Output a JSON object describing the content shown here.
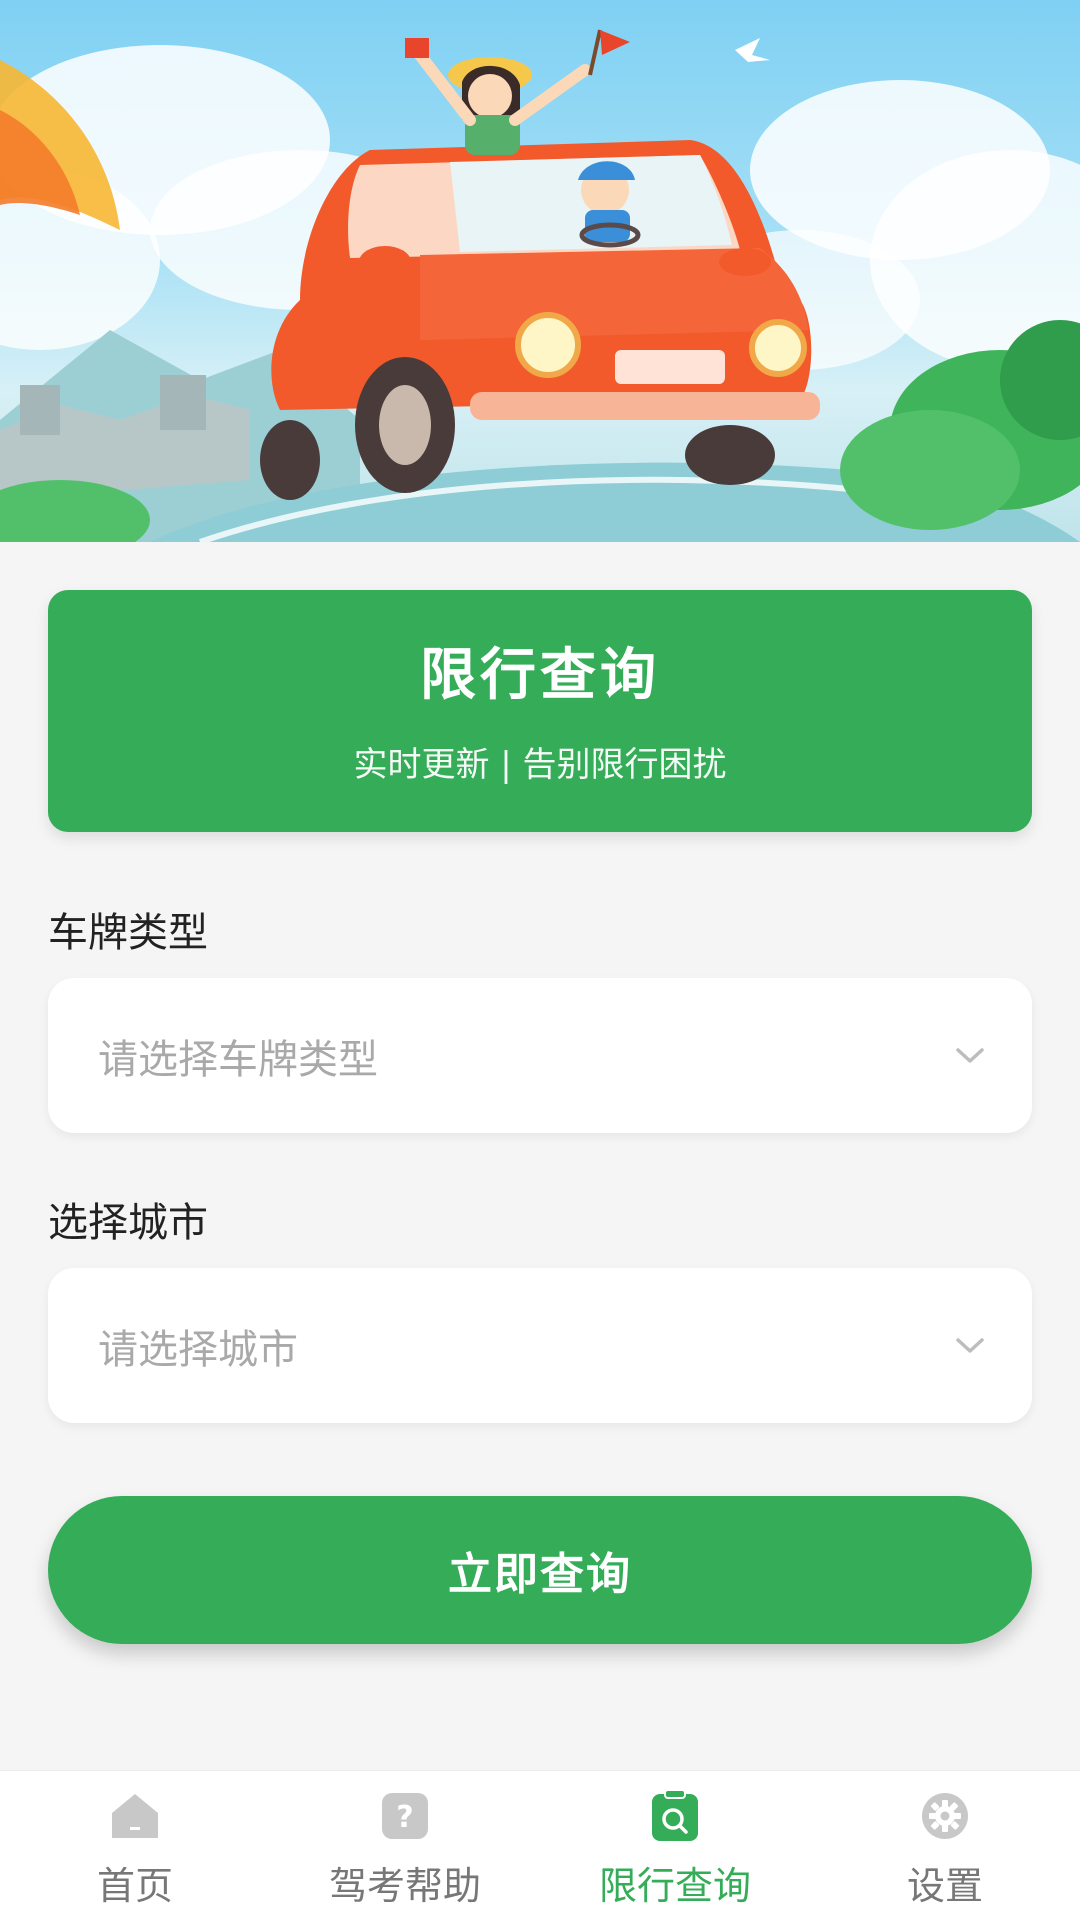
{
  "banner": {
    "title": "限行查询",
    "subtitle": "实时更新 | 告别限行困扰"
  },
  "form": {
    "plate_type_label": "车牌类型",
    "plate_type_placeholder": "请选择车牌类型",
    "city_label": "选择城市",
    "city_placeholder": "请选择城市"
  },
  "query_button": {
    "label": "立即查询"
  },
  "tabbar": {
    "active_index": 2,
    "items": [
      {
        "label": "首页",
        "icon": "home-icon"
      },
      {
        "label": "驾考帮助",
        "icon": "question-icon"
      },
      {
        "label": "限行查询",
        "icon": "search-clipboard-icon"
      },
      {
        "label": "设置",
        "icon": "gear-icon"
      }
    ]
  },
  "colors": {
    "accent": "#34ac58",
    "background": "#f5f5f5",
    "placeholder": "#a9a9a9",
    "inactive_tab": "#777777"
  }
}
